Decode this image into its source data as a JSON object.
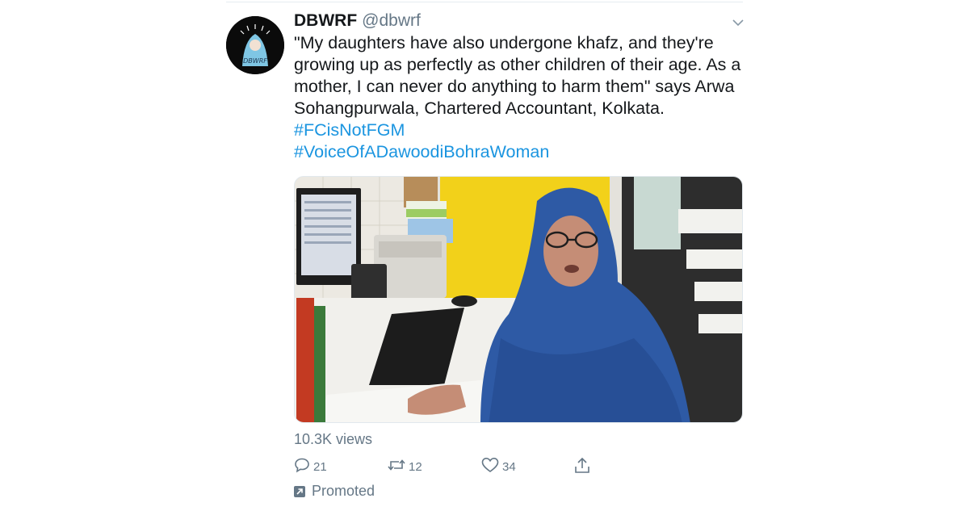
{
  "tweet": {
    "display_name": "DBWRF",
    "handle": "@dbwrf",
    "avatar_text": "DBWRF",
    "text_lines": [
      "\"My daughters have also undergone khafz, and they're",
      "growing up as perfectly as other children of their age. As a",
      "mother, I can never do anything to harm them\" says Arwa",
      "Sohangpurwala, Chartered Accountant, Kolkata."
    ],
    "hashtags": [
      "#FCisNotFGM",
      "#VoiceOfADawoodiBohraWoman"
    ],
    "views": "10.3K views",
    "actions": {
      "reply_count": "21",
      "retweet_count": "12",
      "like_count": "34"
    },
    "promoted_label": "Promoted"
  },
  "colors": {
    "text": "#14171a",
    "secondary": "#657786",
    "link": "#1b95e0",
    "divider": "#e6ecf0"
  },
  "icons": [
    "chevron-down-icon",
    "reply-icon",
    "retweet-icon",
    "like-icon",
    "share-icon",
    "promoted-icon"
  ]
}
